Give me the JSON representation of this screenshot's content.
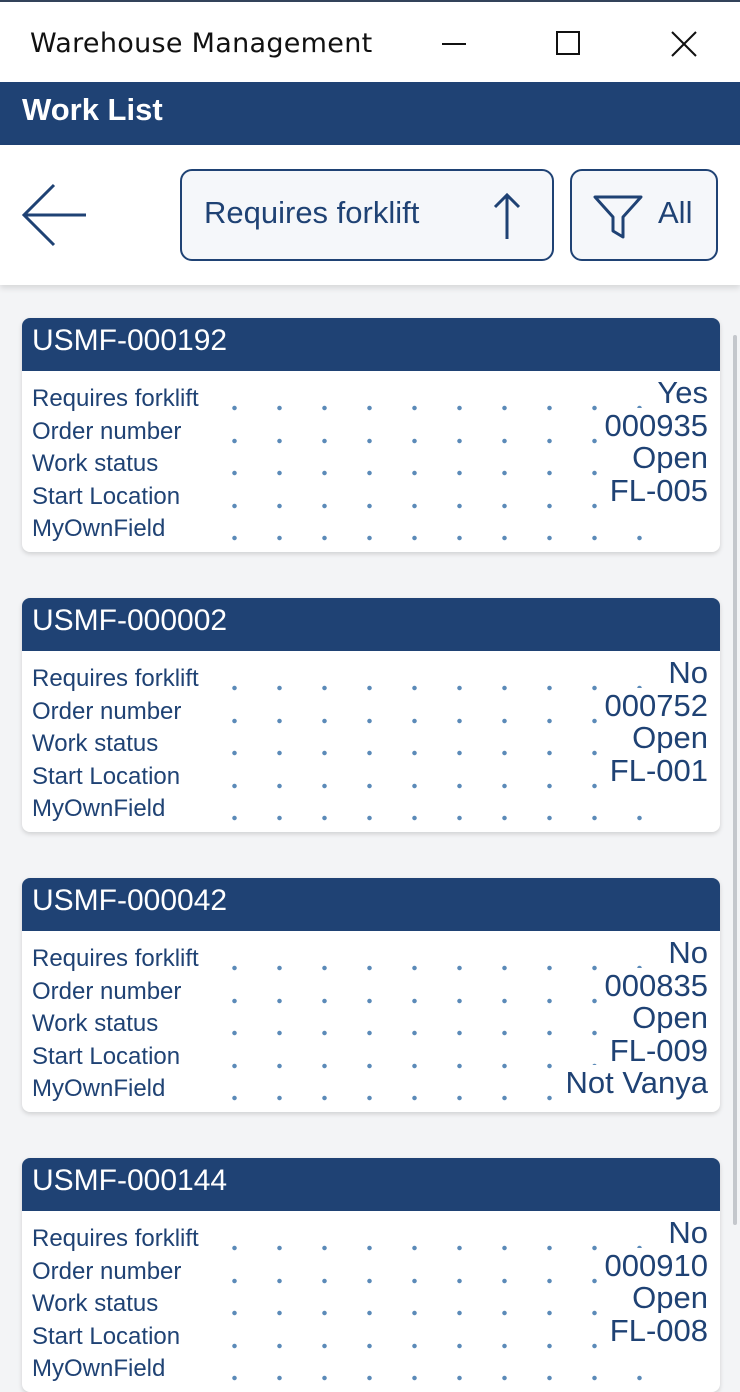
{
  "window": {
    "title": "Warehouse Management",
    "controls": [
      "minimize",
      "maximize",
      "close"
    ]
  },
  "header": {
    "title": "Work List"
  },
  "toolbar": {
    "sort_label": "Requires forklift",
    "sort_direction_icon": "arrow-up-icon",
    "filter_label": "All",
    "filter_icon": "funnel-icon",
    "back_icon": "arrow-left-icon"
  },
  "colors": {
    "accent": "#1f4274",
    "dots": "#5b8ab8",
    "background": "#f3f4f6"
  },
  "field_labels": [
    "Requires forklift",
    "Order number",
    "Work status",
    "Start Location",
    "MyOwnField"
  ],
  "cards": [
    {
      "id": "USMF-000192",
      "values": [
        "Yes",
        "000935",
        "Open",
        "FL-005",
        ""
      ]
    },
    {
      "id": "USMF-000002",
      "values": [
        "No",
        "000752",
        "Open",
        "FL-001",
        ""
      ]
    },
    {
      "id": "USMF-000042",
      "values": [
        "No",
        "000835",
        "Open",
        "FL-009",
        "Not Vanya"
      ]
    },
    {
      "id": "USMF-000144",
      "values": [
        "No",
        "000910",
        "Open",
        "FL-008",
        ""
      ]
    }
  ]
}
